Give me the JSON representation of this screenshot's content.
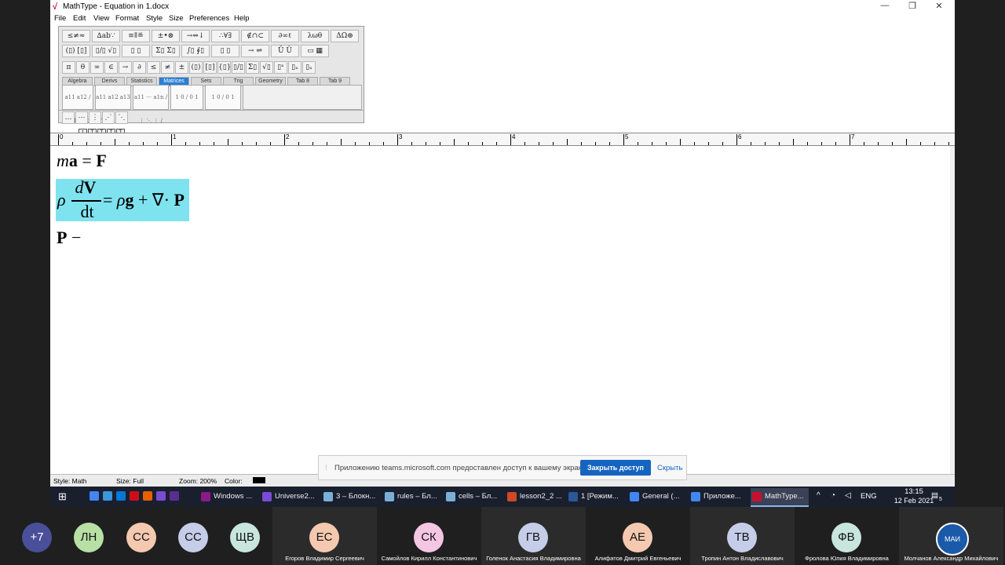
{
  "window": {
    "title": "MathType - Equation in 1.docx",
    "minimize": "—",
    "maximize": "❐",
    "close": "✕"
  },
  "menu": [
    "File",
    "Edit",
    "View",
    "Format",
    "Style",
    "Size",
    "Preferences",
    "Help"
  ],
  "toolbar": {
    "row1": [
      "≤≠≈",
      "∆ab∵",
      "≡ǁ≝",
      "±•⊗",
      "→⇔↓",
      "∴∀∃",
      "∉∩⊂",
      "∂∞ℓ",
      "λωθ",
      "ΔΩ⊛"
    ],
    "row2": [
      "(▯) [▯]",
      "▯/▯ √▯",
      "▯ ▯",
      "Σ▯ Σ▯",
      "∫▯ ∮▯",
      "▯ ▯",
      "→ ⇌",
      "Ū Ǔ",
      "▭ ▦"
    ],
    "row3": [
      "π",
      "θ",
      "∞",
      "∈",
      "→",
      "∂",
      "≤",
      "≠",
      "±",
      "(▯)",
      "[▯]",
      "{▯}",
      "▯/▯",
      "Σ▯",
      "√▯",
      "▯ˣ",
      "▯ₓ",
      "▯ₓ"
    ],
    "tabs": [
      "Algebra",
      "Derivs",
      "Statistics",
      "Matrices",
      "Sets",
      "Trig",
      "Geometry",
      "Tab 8",
      "Tab 9"
    ],
    "active_tab": "Matrices",
    "templates": [
      "a11 a12 / a21 a22",
      "a11 a12 a13 / a21 a22 a23 / a31 a32 a33",
      "a11 ⋯ a1n / ⋮ ⋱ ⋮ / an1 ⋯ ann",
      "1 0 / 0 1",
      "1 0 / 0 1"
    ],
    "dots_row": [
      "…",
      "⋯",
      "⋮",
      "⋰",
      "⋱"
    ],
    "tab_icons": [
      "t",
      "T",
      "T",
      "T",
      "T"
    ]
  },
  "ruler": {
    "labels": [
      "0",
      "1",
      "2",
      "3",
      "4",
      "5",
      "6",
      "7"
    ]
  },
  "equations": [
    {
      "id": "eq1",
      "lhs_italic": "m",
      "lhs_bold": "a",
      "op": "=",
      "rhs_bold": "F"
    },
    {
      "id": "eq2",
      "rho": "ρ",
      "num": "dV",
      "den": "dt",
      "rest_eq": "=",
      "rho2": "ρ",
      "g": "g",
      "plus": "+",
      "nabla": "∇·",
      "P": "P"
    },
    {
      "id": "eq3",
      "bold": "P",
      "op": "−"
    }
  ],
  "statusbar": {
    "style": "Style: Math",
    "size": "Size: Full",
    "zoom": "Zoom: 200%",
    "color": "Color:"
  },
  "share_banner": {
    "message": "Приложению teams.microsoft.com предоставлен доступ к вашему экрану.",
    "stop_button": "Закрыть доступ",
    "hide_button": "Скрыть"
  },
  "taskbar": {
    "tasks": [
      {
        "label": "Windows ...",
        "color": "#8b1a8b"
      },
      {
        "label": "Universe2...",
        "color": "#7b4bd6"
      },
      {
        "label": "3 – Блокн...",
        "color": "#7ab0d8"
      },
      {
        "label": "rules – Бл...",
        "color": "#7ab0d8"
      },
      {
        "label": "cells – Бл...",
        "color": "#7ab0d8"
      },
      {
        "label": "lesson2_2 ...",
        "color": "#d24726"
      },
      {
        "label": "1 [Режим...",
        "color": "#2b579a"
      },
      {
        "label": "General (...",
        "color": "#4285f4"
      },
      {
        "label": "Приложе...",
        "color": "#4285f4"
      },
      {
        "label": "MathType...",
        "color": "#c8102e"
      }
    ],
    "lang": "ENG",
    "time": "13:15",
    "date": "12 Feb 2021",
    "notifications": "5"
  },
  "participants": [
    {
      "initials": "+7",
      "name": "",
      "color": "#4a4f9a"
    },
    {
      "initials": "ЛН",
      "name": "",
      "color": "#b7e0a5"
    },
    {
      "initials": "СС",
      "name": "",
      "color": "#f4c9b0"
    },
    {
      "initials": "СС",
      "name": "",
      "color": "#c5cde8"
    },
    {
      "initials": "ЩВ",
      "name": "",
      "color": "#c9e6de"
    },
    {
      "initials": "ЕС",
      "name": "Егоров Владимир Сергеевич",
      "color": "#f4c9b0"
    },
    {
      "initials": "СК",
      "name": "Самойлов Кирилл Константинович",
      "color": "#f4c6e3"
    },
    {
      "initials": "ГВ",
      "name": "Голенок Анастасия Владимировна",
      "color": "#c5cde8"
    },
    {
      "initials": "АЕ",
      "name": "Алифатов Дмитрий Евгеньевич",
      "color": "#f4c9b0"
    },
    {
      "initials": "ТВ",
      "name": "Тропин Антон Владиславович",
      "color": "#c5cde8"
    },
    {
      "initials": "ФВ",
      "name": "Фролова Юлия Владимировна",
      "color": "#c9e6de"
    },
    {
      "initials": "МАИ",
      "name": "Молчанов Александр Михайлович",
      "color": "#1a5aa8"
    }
  ]
}
